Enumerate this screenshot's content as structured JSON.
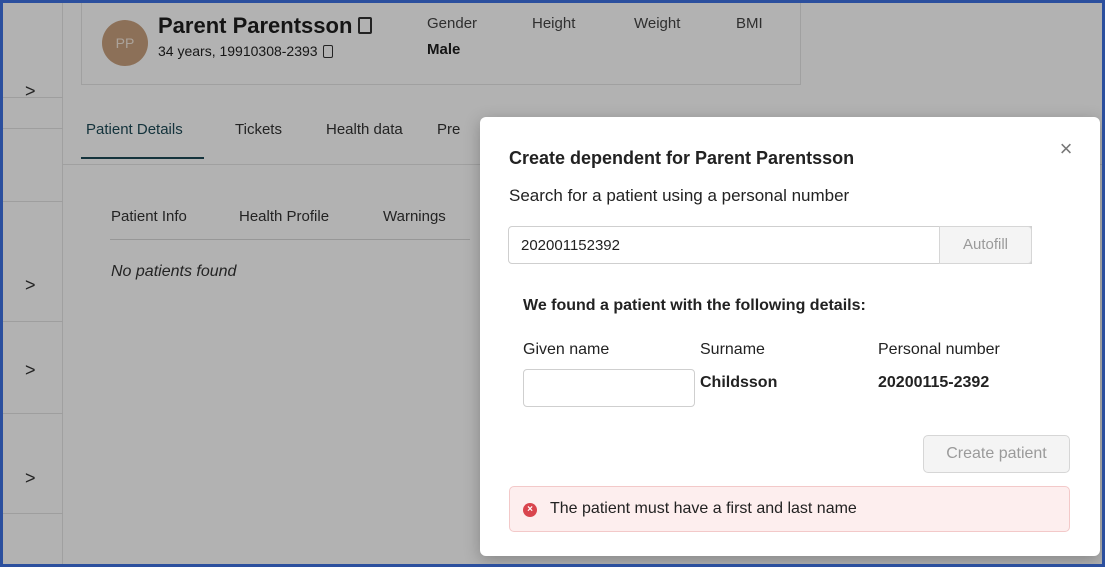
{
  "patient": {
    "initials": "PP",
    "name": "Parent Parentsson",
    "age_and_id": "34 years, 19910308-2393"
  },
  "metrics": [
    {
      "label": "Gender",
      "value": "Male"
    },
    {
      "label": "Height",
      "value": ""
    },
    {
      "label": "Weight",
      "value": ""
    },
    {
      "label": "BMI",
      "value": ""
    }
  ],
  "tabs": [
    "Patient Details",
    "Tickets",
    "Health data",
    "Pre"
  ],
  "subtabs": [
    "Patient Info",
    "Health Profile",
    "Warnings"
  ],
  "empty_message": "No patients found",
  "modal": {
    "title": "Create dependent for Parent Parentsson",
    "subtitle": "Search for a patient using a personal number",
    "search_value": "202001152392",
    "autofill_label": "Autofill",
    "found_text": "We found a patient with the following details:",
    "columns": {
      "given_name": "Given name",
      "surname": "Surname",
      "personal_number": "Personal number"
    },
    "values": {
      "given_name": "",
      "surname": "Childsson",
      "personal_number": "20200115-2392"
    },
    "create_label": "Create patient",
    "error_message": "The patient must have a first and last name",
    "close_glyph": "×",
    "error_glyph": "×"
  },
  "rail": {
    "chevron_glyph": ">"
  },
  "colors": {
    "accent": "#1e4a56",
    "frame": "#2b4f9e",
    "error": "#d9454e",
    "avatar": "#c9a17e"
  }
}
